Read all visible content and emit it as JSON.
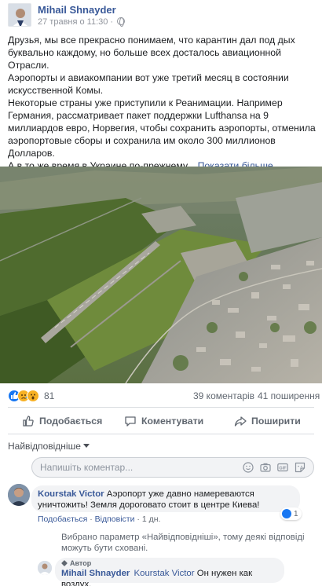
{
  "post": {
    "author": "Mihail Shnayder",
    "date": "27 травня о 11:30 ·",
    "paragraphs": [
      "Друзья, мы все прекрасно понимаем, что карантин дал под дых буквально каждому, но больше всех досталось авиационной Отрасли.",
      "Аэропорты и авиакомпании вот уже третий месяц в состоянии искусственной Комы.",
      "Некоторые страны уже приступили к Реанимации. Например Германия, рассматривает пакет поддержки Lufthansa на 9 миллиардов евро, Норвегия, чтобы сохранить аэропорты, отменила аэропортовые сборы и сохранила им около 300 миллионов Долларов."
    ],
    "last_line": "А в то же время в Украине по-прежнему...",
    "see_more": "Показати більше..."
  },
  "stats": {
    "reaction_count": "81",
    "comments": "39 коментарів",
    "shares": "41 поширення"
  },
  "actions": {
    "like": "Подобається",
    "comment": "Коментувати",
    "share": "Поширити"
  },
  "comments_section": {
    "sort_label": "Найвідповідніше",
    "composer_placeholder": "Напишіть коментар...",
    "comment": {
      "author": "Kourstak Victor",
      "text": "Аэропорт уже давно намереваются уничтожить! Земля дороговато стоит в центре Киева!",
      "like": "Подобається",
      "separator": "·",
      "reply": "Відповісти",
      "age": "1 дн.",
      "like_count": "1"
    },
    "notice": "Вибрано параметр «Найвідповідніші», тому деякі відповіді можуть бути сховані.",
    "reply": {
      "badge": "Автор",
      "author": "Mihail Shnayder",
      "mention": "Kourstak Victor",
      "text": "Он нужен как воздух."
    }
  },
  "colors": {
    "link": "#385898",
    "like_blue": "#1877f2",
    "secondary_text": "#606770"
  }
}
